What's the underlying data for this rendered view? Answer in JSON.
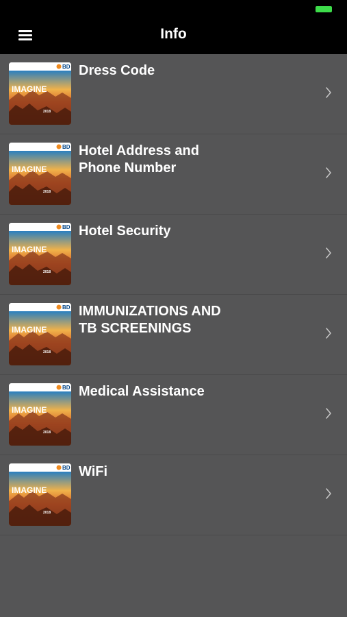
{
  "status_bar": {
    "battery_color": "#3ddc4a"
  },
  "nav": {
    "title": "Info",
    "menu_icon": "hamburger-menu-icon"
  },
  "list": {
    "items": [
      {
        "title": "Dress Code"
      },
      {
        "title": "Hotel Address and\nPhone Number"
      },
      {
        "title": "Hotel Security"
      },
      {
        "title": "IMMUNIZATIONS AND\nTB SCREENINGS"
      },
      {
        "title": "Medical Assistance"
      },
      {
        "title": "WiFi"
      }
    ]
  },
  "thumbnail": {
    "brand": "BD",
    "headline": "IMAGINE",
    "year": "2018"
  },
  "colors": {
    "background": "#555556",
    "bar": "#000000",
    "text": "#ffffff",
    "chevron": "#c8c8c8"
  }
}
